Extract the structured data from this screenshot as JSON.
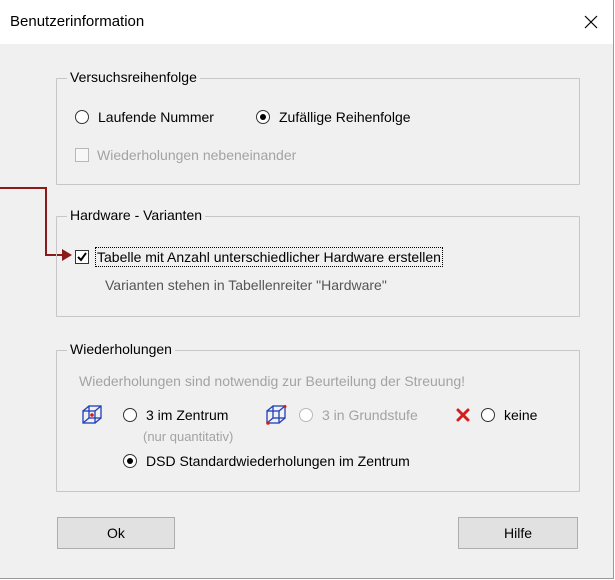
{
  "window": {
    "title": "Benutzerinformation",
    "close_glyph": "✕"
  },
  "sequence_group": {
    "label": "Versuchsreihenfolge",
    "options": [
      {
        "label": "Laufende Nummer",
        "checked": false
      },
      {
        "label": "Zufällige Reihenfolge",
        "checked": true
      }
    ],
    "repeat_side_by_side": {
      "label": "Wiederholungen nebeneinander",
      "checked": false,
      "enabled": false
    }
  },
  "hardware_group": {
    "label": "Hardware - Varianten",
    "table_checkbox": {
      "label": "Tabelle mit Anzahl unterschiedlicher Hardware erstellen",
      "checked": true
    },
    "hint": "Varianten stehen in Tabellenreiter \"Hardware\""
  },
  "repeats_group": {
    "label": "Wiederholungen",
    "info": "Wiederholungen sind notwendig zur Beurteilung der Streuung!",
    "center": {
      "label": "3 im Zentrum",
      "sublabel": "(nur quantitativ)",
      "checked": false,
      "icon": "cube-icon"
    },
    "base": {
      "label": "3 in Grundstufe",
      "checked": false,
      "enabled": false,
      "icon": "cube-icon"
    },
    "none": {
      "label": "keine",
      "checked": false,
      "icon": "red-x-icon"
    },
    "dsd": {
      "label": "DSD Standardwiederholungen im Zentrum",
      "checked": true
    }
  },
  "buttons": {
    "ok": "Ok",
    "help": "Hilfe"
  },
  "colors": {
    "arrow": "#8b1a1a",
    "cube": "#1e3fb8",
    "red_x": "#d21e1e",
    "accent": "#0078d7"
  }
}
